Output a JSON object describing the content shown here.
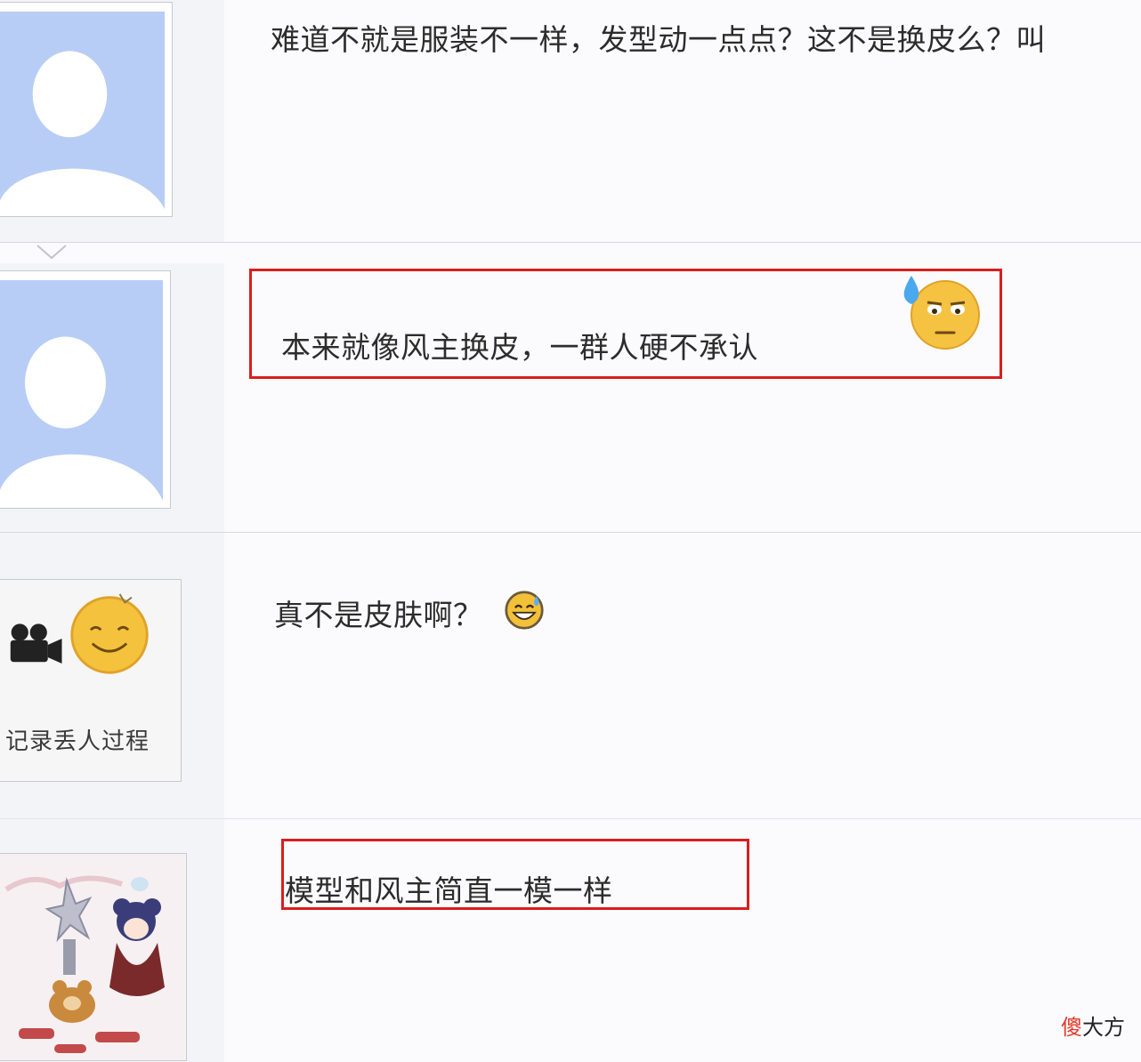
{
  "posts": [
    {
      "text": "难道不就是服装不一样，发型动一点点？这不是换皮么？叫",
      "avatar": "default-avatar"
    },
    {
      "text": "本来就像风主换皮，一群人硬不承认",
      "avatar": "default-avatar",
      "emoji": "sweat-emoji",
      "highlighted": true
    },
    {
      "text": "真不是皮肤啊？",
      "avatar": "camera-smiley-avatar",
      "avatar_caption": "记录丢人过程",
      "emoji": "grin-sweat-emoji"
    },
    {
      "text": "模型和风主简直一模一样",
      "avatar": "anime-character-avatar",
      "highlighted": true
    }
  ],
  "watermark": {
    "first": "傻",
    "rest": "大方"
  },
  "colors": {
    "highlight": "#d81e1e",
    "avatar_bg": "#b8cdf6",
    "left_column_bg": "#f3f4f8"
  }
}
